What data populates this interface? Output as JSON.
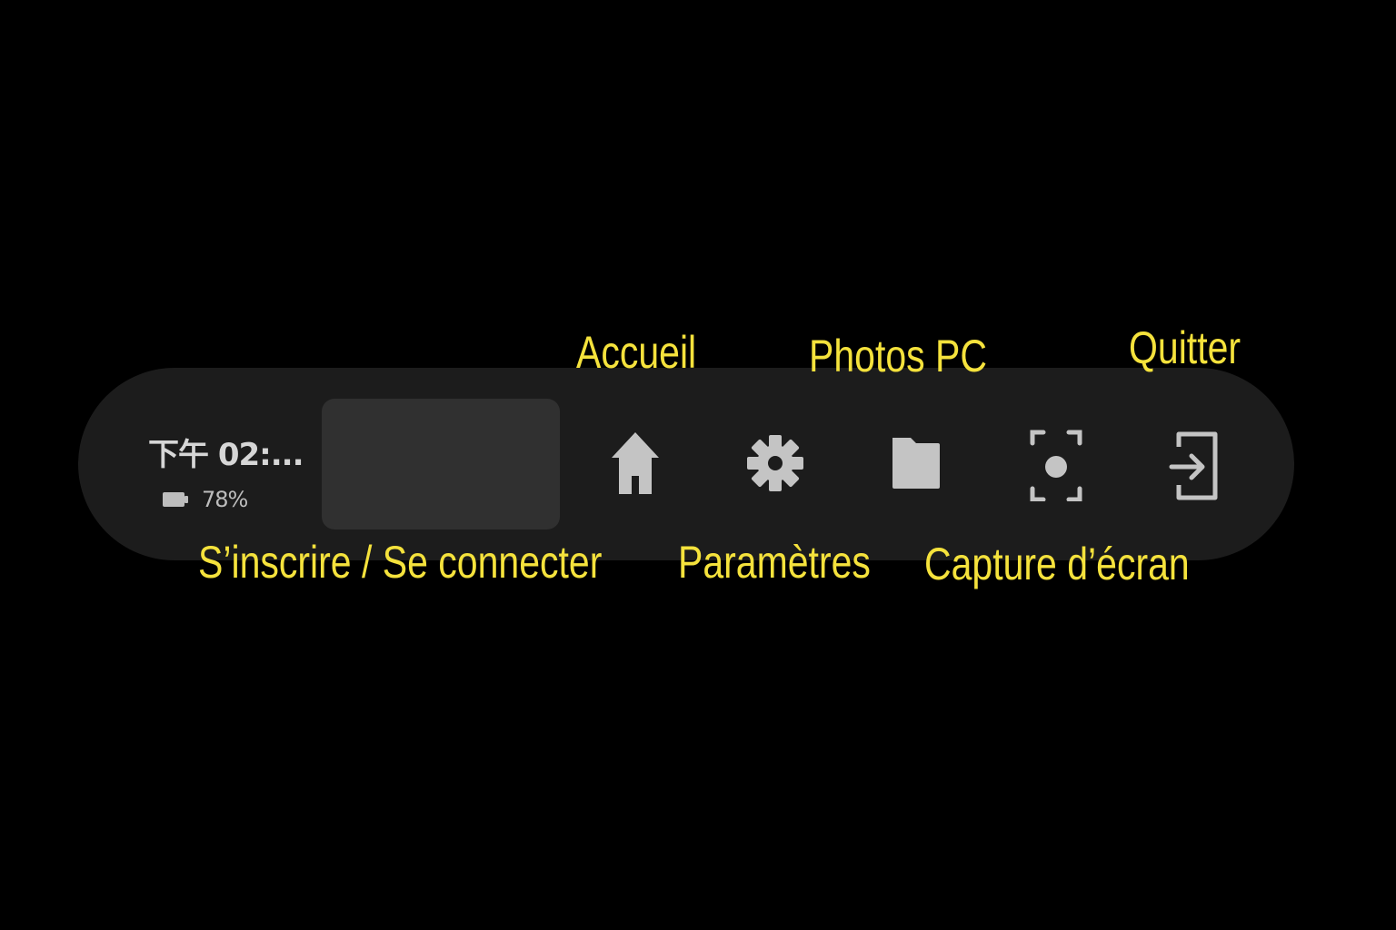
{
  "status": {
    "time": "下午 02:...",
    "battery_percent": "78%",
    "battery_icon": "battery-icon"
  },
  "toolbar": {
    "buttons": [
      {
        "id": "account",
        "icon": "account-placeholder",
        "label": "S’inscrire / Se connecter"
      },
      {
        "id": "home",
        "icon": "home-icon",
        "label": "Accueil"
      },
      {
        "id": "settings",
        "icon": "gear-icon",
        "label": "Paramètres"
      },
      {
        "id": "pc-photos",
        "icon": "folder-icon",
        "label": "Photos PC"
      },
      {
        "id": "screenshot",
        "icon": "screenshot-icon",
        "label": "Capture d’écran"
      },
      {
        "id": "quit",
        "icon": "exit-icon",
        "label": "Quitter"
      }
    ]
  },
  "colors": {
    "background": "#000000",
    "bar": "#1c1c1c",
    "account_box": "#303030",
    "icon": "#c4c4c4",
    "callout_text": "#f5e23c"
  }
}
